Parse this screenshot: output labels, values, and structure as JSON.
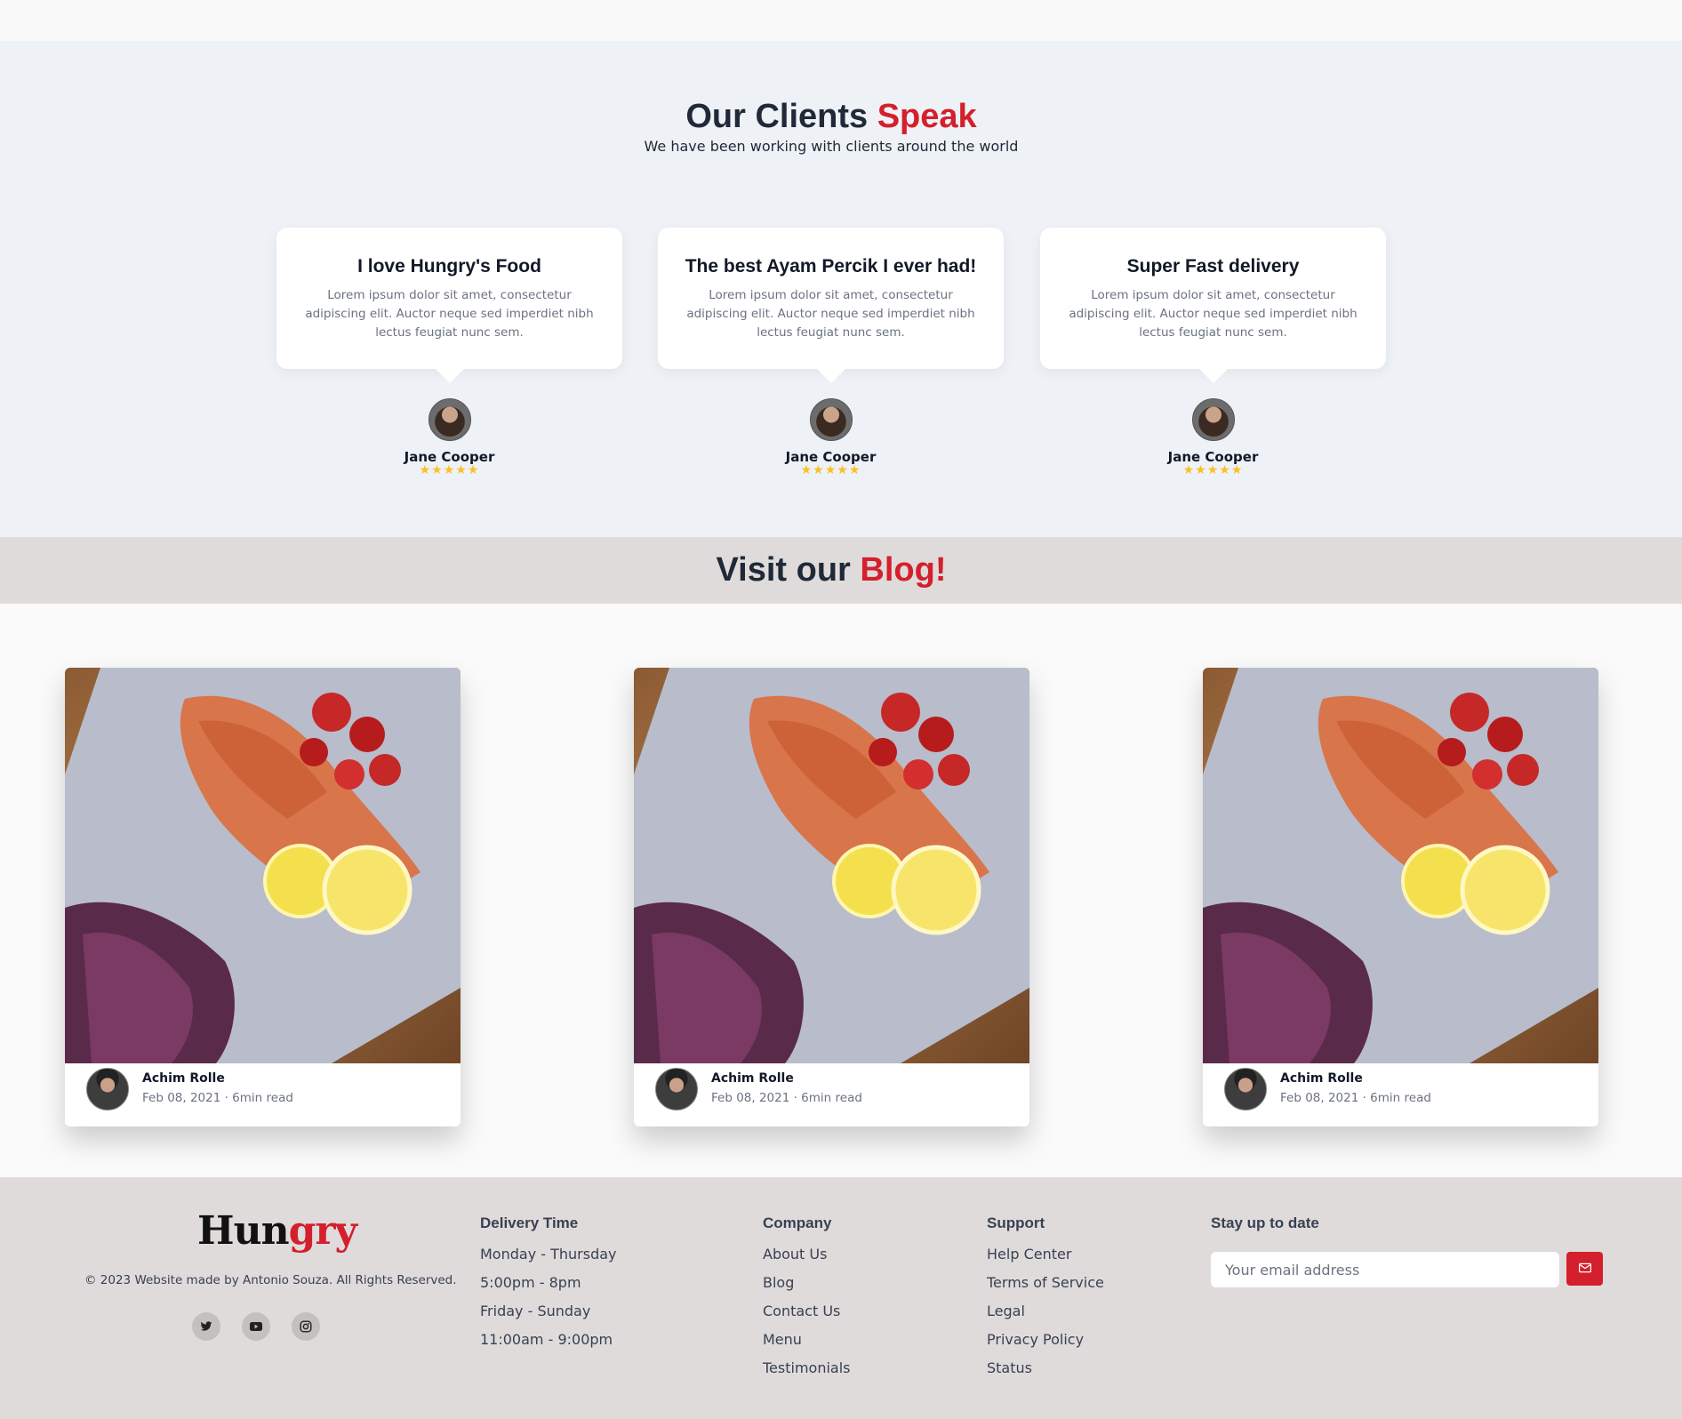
{
  "clients": {
    "title_main": "Our Clients",
    "title_accent": "Speak",
    "subtitle": "We have been working with clients around the world",
    "testimonials": [
      {
        "heading": "I love Hungry's Food",
        "text": "Lorem ipsum dolor sit amet, consectetur adipiscing elit. Auctor neque sed imperdiet nibh lectus feugiat nunc sem.",
        "name": "Jane Cooper",
        "rating": 5
      },
      {
        "heading": "The best Ayam Percik I ever had!",
        "text": "Lorem ipsum dolor sit amet, consectetur adipiscing elit. Auctor neque sed imperdiet nibh lectus feugiat nunc sem.",
        "name": "Jane Cooper",
        "rating": 5
      },
      {
        "heading": "Super Fast delivery",
        "text": "Lorem ipsum dolor sit amet, consectetur adipiscing elit. Auctor neque sed imperdiet nibh lectus feugiat nunc sem.",
        "name": "Jane Cooper",
        "rating": 5
      }
    ],
    "stars": "★★★★★"
  },
  "blog": {
    "title_main": "Visit our",
    "title_accent": "Blog!",
    "posts": [
      {
        "author": "Achim Rolle",
        "date": "Feb 08, 2021 · 6min read"
      },
      {
        "author": "Achim Rolle",
        "date": "Feb 08, 2021 · 6min read"
      },
      {
        "author": "Achim Rolle",
        "date": "Feb 08, 2021 · 6min read"
      }
    ]
  },
  "footer": {
    "logo_black": "Hun",
    "logo_red": "gry",
    "copyright": "© 2023 Website made by Antonio Souza. All Rights Reserved.",
    "social": [
      "twitter-icon",
      "youtube-icon",
      "instagram-icon"
    ],
    "delivery": {
      "heading": "Delivery Time",
      "items": [
        "Monday - Thursday",
        "5:00pm - 8pm",
        "Friday - Sunday",
        "11:00am - 9:00pm"
      ]
    },
    "company": {
      "heading": "Company",
      "items": [
        "About Us",
        "Blog",
        "Contact Us",
        "Menu",
        "Testimonials"
      ]
    },
    "support": {
      "heading": "Support",
      "items": [
        "Help Center",
        "Terms of Service",
        "Legal",
        "Privacy Policy",
        "Status"
      ]
    },
    "newsletter": {
      "heading": "Stay up to date",
      "placeholder": "Your email address"
    }
  },
  "colors": {
    "accent": "#d41f2c",
    "star": "#fbbf24",
    "footer_bg": "#e0dbdb",
    "section_bg": "#eef1f5"
  }
}
